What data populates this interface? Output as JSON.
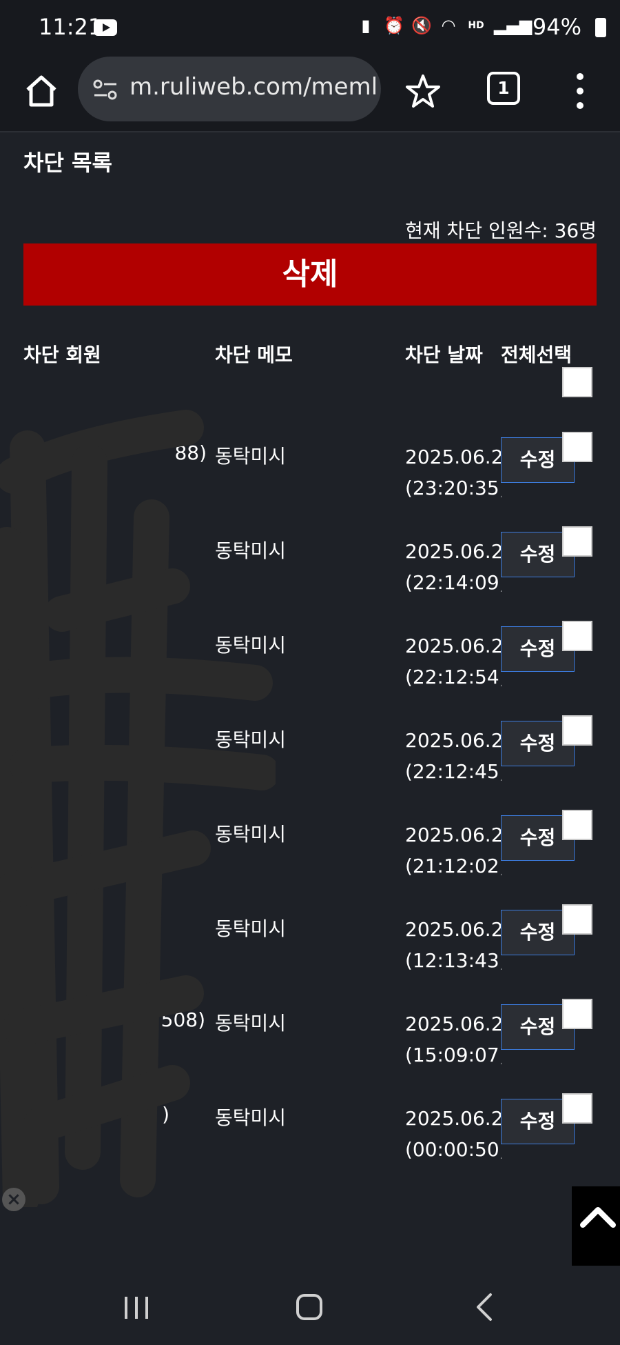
{
  "status_bar": {
    "time": "11:21",
    "battery_percent": "94%"
  },
  "browser": {
    "url": "m.ruliweb.com/meml",
    "tab_count": "1"
  },
  "page": {
    "title": "차단 목록",
    "count_text": "현재 차단 인원수: 36명",
    "delete_label": "삭제",
    "columns": {
      "member": "차단 회원",
      "memo": "차단 메모",
      "date": "차단 날짜",
      "select_all": "전체선택"
    },
    "edit_label": "수정",
    "rows": [
      {
        "member": "88)",
        "memo": "동탁미시",
        "date": "2025.06.2",
        "time": "(23:20:35)"
      },
      {
        "member": "",
        "memo": "동탁미시",
        "date": "2025.06.2",
        "time": "(22:14:09)"
      },
      {
        "member": "",
        "memo": "동탁미시",
        "date": "2025.06.2",
        "time": "(22:12:54)"
      },
      {
        "member": "",
        "memo": "동탁미시",
        "date": "2025.06.2",
        "time": "(22:12:45)"
      },
      {
        "member": "",
        "memo": "동탁미시",
        "date": "2025.06.2",
        "time": "(21:12:02)"
      },
      {
        "member": "",
        "memo": "동탁미시",
        "date": "2025.06.2",
        "time": "(12:13:43)"
      },
      {
        "member": "508)",
        "memo": "동탁미시",
        "date": "2025.06.2",
        "time": "(15:09:07)"
      },
      {
        "member": ")",
        "memo": "동탁미시",
        "date": "2025.06.2",
        "time": "(00:00:50)"
      }
    ]
  },
  "colors": {
    "background": "#1e2127",
    "delete_button": "#b10000",
    "edit_border": "#3d7de0"
  },
  "icons": [
    "home-icon",
    "tune-icon",
    "star-icon",
    "tabs-icon",
    "more-vert-icon",
    "chevron-up-icon",
    "close-icon",
    "recent-apps-icon",
    "nav-home-icon",
    "back-icon"
  ]
}
